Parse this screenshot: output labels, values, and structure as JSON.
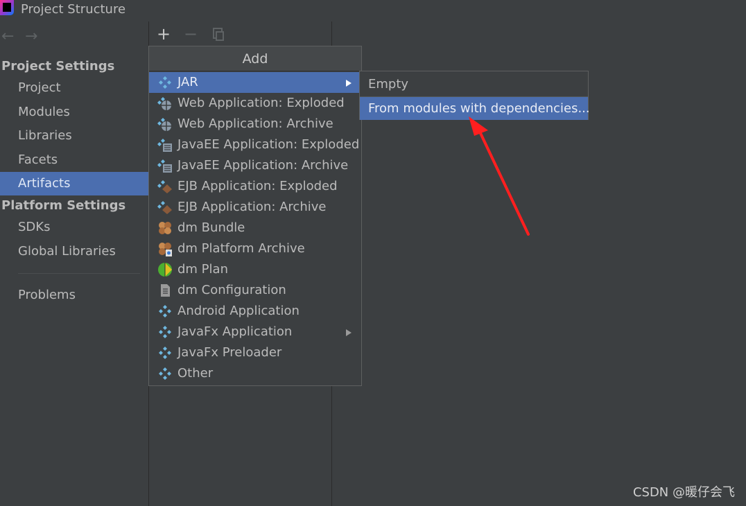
{
  "window": {
    "title": "Project Structure"
  },
  "sidebar": {
    "back_icon": "arrow-left-icon",
    "forward_icon": "arrow-right-icon",
    "project_settings_header": "Project Settings",
    "project_items": [
      {
        "label": "Project"
      },
      {
        "label": "Modules"
      },
      {
        "label": "Libraries"
      },
      {
        "label": "Facets"
      },
      {
        "label": "Artifacts",
        "selected": true
      }
    ],
    "platform_settings_header": "Platform Settings",
    "platform_items": [
      {
        "label": "SDKs"
      },
      {
        "label": "Global Libraries"
      }
    ],
    "problems": "Problems"
  },
  "toolbar": {
    "add": "+",
    "remove": "−",
    "copy_icon": "copy-icon"
  },
  "add_menu": {
    "header": "Add",
    "items": [
      {
        "label": "JAR",
        "icon": "jar-icon",
        "submenu": true,
        "selected": true
      },
      {
        "label": "Web Application: Exploded",
        "icon": "web-app-icon"
      },
      {
        "label": "Web Application: Archive",
        "icon": "web-app-icon"
      },
      {
        "label": "JavaEE Application: Exploded",
        "icon": "javaee-icon"
      },
      {
        "label": "JavaEE Application: Archive",
        "icon": "javaee-icon"
      },
      {
        "label": "EJB Application: Exploded",
        "icon": "ejb-icon"
      },
      {
        "label": "EJB Application: Archive",
        "icon": "ejb-icon"
      },
      {
        "label": "dm Bundle",
        "icon": "dm-bundle-icon"
      },
      {
        "label": "dm Platform Archive",
        "icon": "dm-platform-icon"
      },
      {
        "label": "dm Plan",
        "icon": "dm-plan-icon"
      },
      {
        "label": "dm Configuration",
        "icon": "dm-config-icon"
      },
      {
        "label": "Android Application",
        "icon": "android-icon"
      },
      {
        "label": "JavaFx Application",
        "icon": "javafx-icon",
        "submenu": true
      },
      {
        "label": "JavaFx Preloader",
        "icon": "javafx-icon"
      },
      {
        "label": "Other",
        "icon": "other-icon"
      }
    ]
  },
  "jar_submenu": {
    "items": [
      {
        "label": "Empty"
      },
      {
        "label": "From modules with dependencies...",
        "selected": true
      }
    ]
  },
  "colors": {
    "background": "#3c3f41",
    "selection": "#4b6eaf",
    "annotation_arrow": "#ff1f1f"
  },
  "watermark": "CSDN @暖仔会飞"
}
